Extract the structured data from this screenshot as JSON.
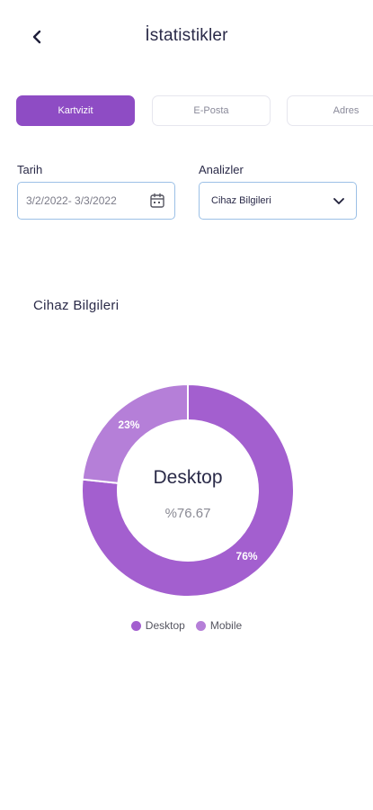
{
  "header": {
    "title": "İstatistikler"
  },
  "tabs": [
    {
      "label": "Kartvizit",
      "active": true
    },
    {
      "label": "E-Posta",
      "active": false
    },
    {
      "label": "Adres",
      "active": false
    }
  ],
  "filters": {
    "date_label": "Tarih",
    "date_value": "3/2/2022- 3/3/2022",
    "analysis_label": "Analizler",
    "analysis_value": "Cihaz Bilgileri"
  },
  "section": {
    "title": "Cihaz Bilgileri"
  },
  "chart_data": {
    "type": "pie",
    "donut": true,
    "categories": [
      "Desktop",
      "Mobile"
    ],
    "values": [
      76.67,
      23.33
    ],
    "slice_labels": [
      "76%",
      "23%"
    ],
    "center_label": "Desktop",
    "center_value": "%76.67",
    "colors": [
      "#a35fcf",
      "#b57fd8"
    ],
    "legend": [
      "Desktop",
      "Mobile"
    ],
    "legend_position": "bottom"
  },
  "colors": {
    "accent": "#8e4cc4",
    "field_border": "#9cc0e6"
  }
}
